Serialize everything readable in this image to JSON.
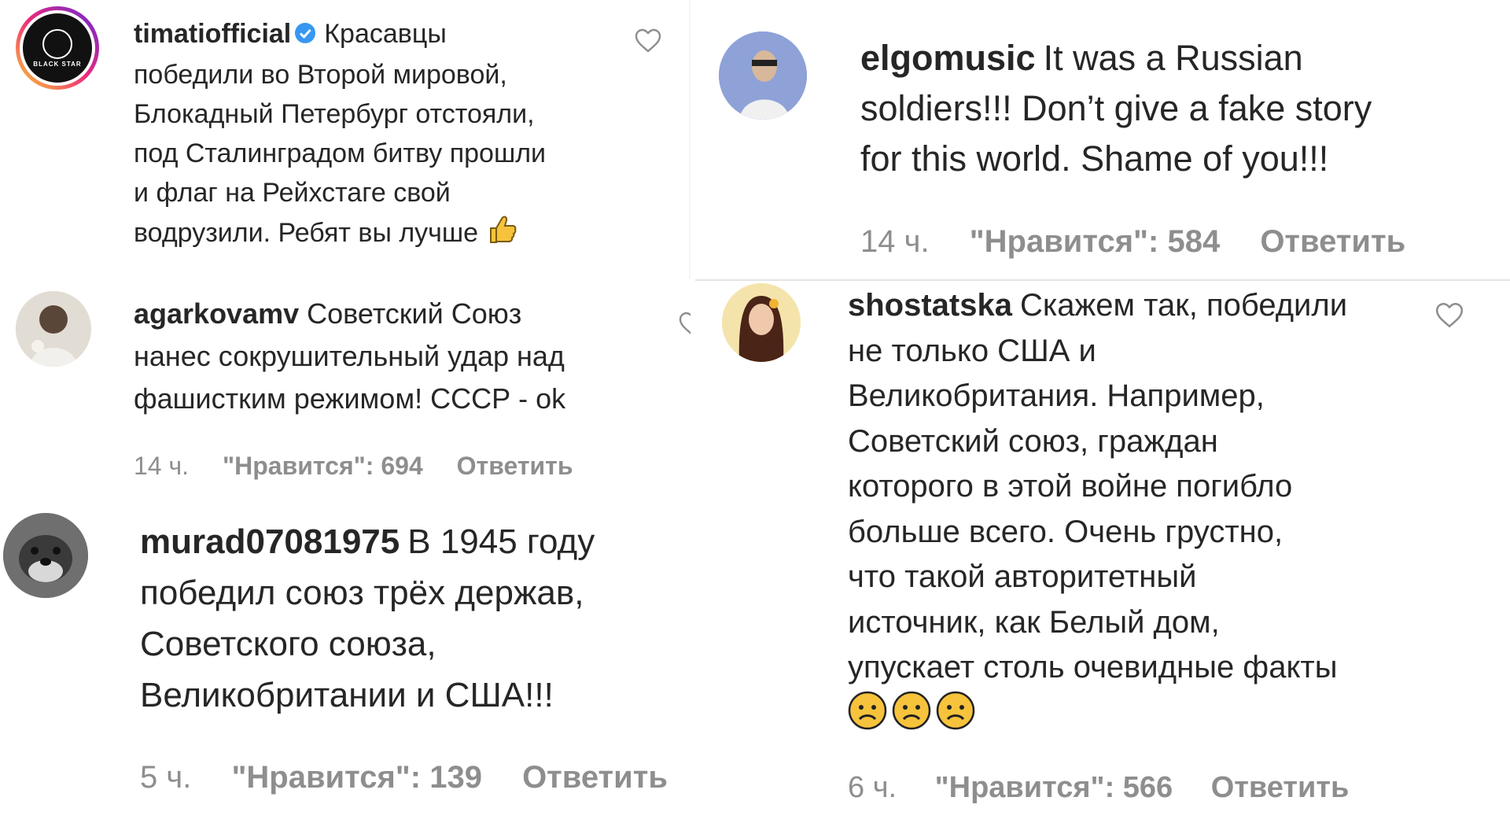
{
  "comments": [
    {
      "user": "timatiofficial",
      "verified": true,
      "text": "Красавцы\nпобедили во Второй мировой,\nБлокадный Петербург отстояли,\nпод Сталинградом битву прошли\nи флаг на Рейхстаге свой\nводрузили. Ребят вы лучше",
      "emoji": "thumbs-up",
      "avatar_label": "BLACK STAR"
    },
    {
      "user": "agarkovamv",
      "text": "Советский Союз\nнанес сокрушительный удар над\nфашистким режимом! СССР - ok",
      "time": "14 ч.",
      "likes": "\"Нравится\": 694",
      "reply": "Ответить"
    },
    {
      "user": "murad07081975",
      "text": "В 1945 году\nпобедил союз трёх держав,\nСоветского союза,\nВеликобритании и США!!!",
      "time": "5 ч.",
      "likes": "\"Нравится\": 139",
      "reply": "Ответить"
    },
    {
      "user": "elgomusic",
      "text": "It was a Russian\nsoldiers!!! Don’t give a fake story\nfor this world. Shame of you!!!",
      "time": "14 ч.",
      "likes": "\"Нравится\": 584",
      "reply": "Ответить"
    },
    {
      "user": "shostatska",
      "text": "Скажем так, победили\nне только США и\nВеликобритания. Например,\nСоветский союз, граждан\nкоторого в этой войне погибло\nбольше всего. Очень грустно,\nчто такой авторитетный\nисточник, как Белый дом,\nупускает столь очевидные факты",
      "emojis": [
        "worried-face",
        "worried-face",
        "worried-face"
      ],
      "time": "6 ч.",
      "likes": "\"Нравится\": 566",
      "reply": "Ответить"
    }
  ],
  "colors": {
    "text": "#262626",
    "meta": "#8e8e8e",
    "verified": "#3897f0",
    "emoji": "#f7c33c",
    "story_ring": "#d6249f"
  }
}
